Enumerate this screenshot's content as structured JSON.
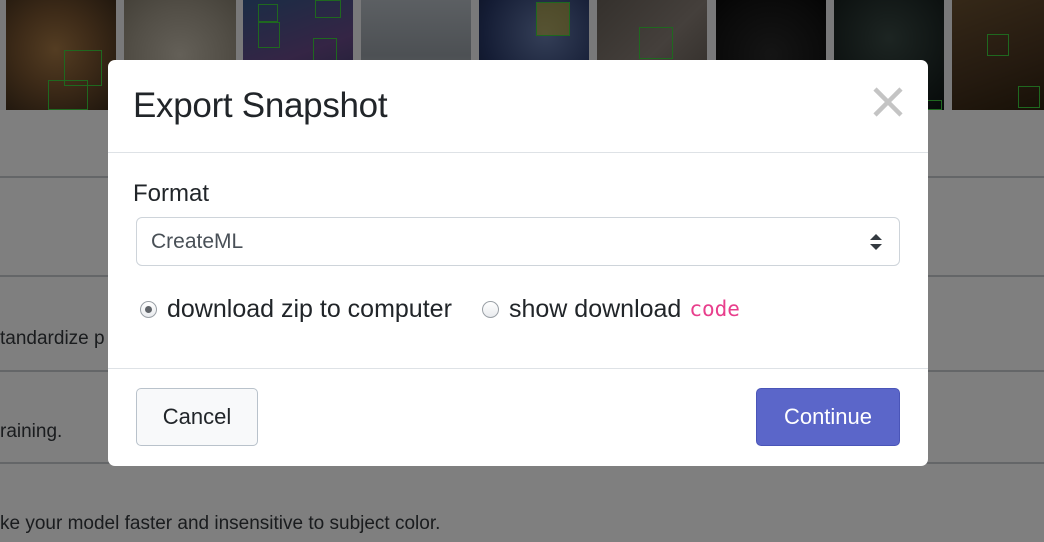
{
  "background": {
    "text_lines": [
      "tandardize p",
      "raining.",
      "ke your model faster and insensitive to subject color."
    ]
  },
  "modal": {
    "title": "Export Snapshot",
    "close_icon": "close-icon",
    "format_label": "Format",
    "format_value": "CreateML",
    "options": [
      {
        "label": "download zip to computer",
        "selected": true
      },
      {
        "label": "show download",
        "code": "code",
        "selected": false
      }
    ],
    "cancel_label": "Cancel",
    "continue_label": "Continue"
  },
  "colors": {
    "accent": "#5b66c9",
    "code": "#e83e8c",
    "bbox": "#3ed13e"
  }
}
